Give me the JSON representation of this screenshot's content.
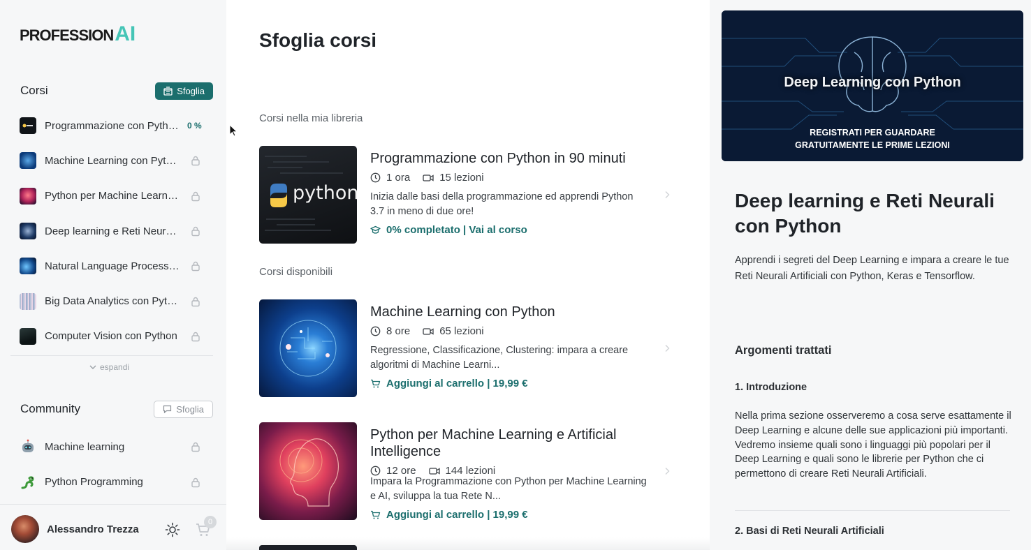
{
  "brand": {
    "logo_text": "PROFESSION",
    "logo_ai": "AI"
  },
  "sidebar": {
    "courses_title": "Corsi",
    "courses_browse": "Sfoglia",
    "courses": [
      {
        "label": "Programmazione con Python in 90 minuti",
        "status": "0 %",
        "thumb": "python"
      },
      {
        "label": "Machine Learning con Python",
        "thumb": "ml"
      },
      {
        "label": "Python per Machine Learning e Artificial Intelligence",
        "thumb": "ai"
      },
      {
        "label": "Deep learning e Reti Neurali con Python",
        "thumb": "dl"
      },
      {
        "label": "Natural Language Processing con Python",
        "thumb": "nlp"
      },
      {
        "label": "Big Data Analytics con Python",
        "thumb": "bd"
      },
      {
        "label": "Computer Vision con Python",
        "thumb": "cv"
      }
    ],
    "expand_label": "espandi",
    "community_title": "Community",
    "community_browse": "Sfoglia",
    "communities": [
      {
        "label": "Machine learning",
        "icon": "robot-icon"
      },
      {
        "label": "Python Programming",
        "icon": "python-snake-icon"
      }
    ],
    "user": {
      "name": "Alessandro Trezza",
      "cart_count": "0"
    }
  },
  "main": {
    "title": "Sfoglia corsi",
    "library_heading": "Corsi nella mia libreria",
    "available_heading": "Corsi disponibili",
    "library_course": {
      "title": "Programmazione con Python in 90 minuti",
      "duration": "1 ora",
      "lessons": "15 lezioni",
      "description": "Inizia dalle basi della programmazione ed apprendi Python 3.7 in meno di due ore!",
      "cta": "0% completato | Vai al corso",
      "thumb_text": "python"
    },
    "available_courses": [
      {
        "title": "Machine Learning con Python",
        "duration": "8 ore",
        "lessons": "65 lezioni",
        "description": "Regressione, Classificazione, Clustering: impara a creare algoritmi di Machine Learni...",
        "cta": "Aggiungi al carrello | 19,99 €"
      },
      {
        "title": "Python per Machine Learning e Artificial Intelligence",
        "duration": "12 ore",
        "lessons": "144 lezioni",
        "description": "Impara la Programmazione con Python per Machine Learning e AI, sviluppa la tua Rete N...",
        "cta": "Aggiungi al carrello | 19,99 €"
      }
    ]
  },
  "detail": {
    "banner_title": "Deep Learning con Python",
    "banner_subtitle_line1": "REGISTRATI PER GUARDARE",
    "banner_subtitle_line2": "GRATUITAMENTE LE PRIME LEZIONI",
    "title": "Deep learning e Reti Neurali con Python",
    "description": "Apprendi i segreti del Deep Learning e impara a creare le tue Reti Neurali Artificiali con Python, Keras e Tensorflow.",
    "topics_heading": "Argomenti trattati",
    "sections": [
      {
        "heading": "1. Introduzione",
        "body": "Nella prima sezione osserveremo a cosa serve esattamente il Deep Learning e alcune delle sue applicazioni più importanti. Vedremo insieme quali sono i linguaggi più popolari per il Deep Learning e quali sono le librerie per Python che ci permettono di creare Reti Neurali Artificiali."
      },
      {
        "heading": "2. Basi di Reti Neurali Artificiali"
      }
    ]
  },
  "colors": {
    "accent": "#1b6e6d",
    "logo_ai": "#45c5b6",
    "sidebar_bg": "#f6f7f8"
  }
}
